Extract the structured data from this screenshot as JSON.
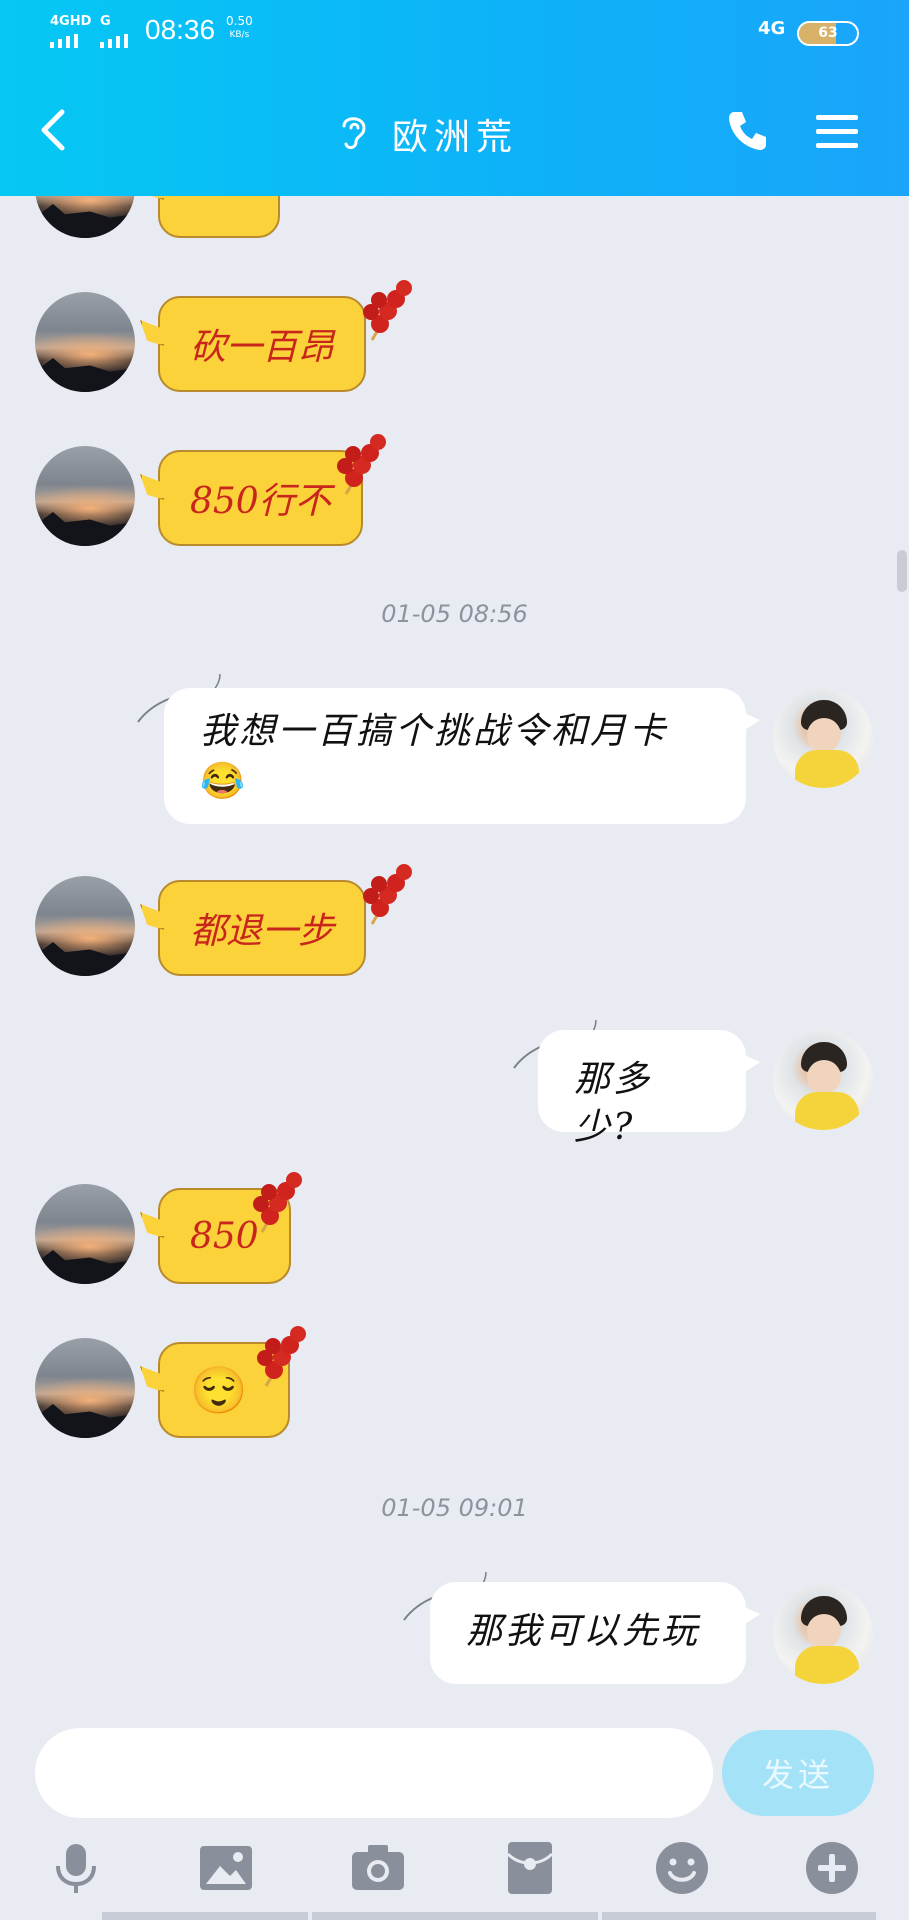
{
  "status_bar": {
    "signal_1": "4GHD",
    "signal_2": "G",
    "time": "08:36",
    "speed_value": "0.50",
    "speed_unit": "KB/s",
    "network_right": "4G",
    "battery": "63",
    "battery_level": 0.63,
    "battery_color": "#d9b26a"
  },
  "header": {
    "title": "欧洲荒",
    "back_icon": "chevron-left-icon",
    "ear_icon": "ear-icon",
    "call_icon": "phone-icon",
    "menu_icon": "hamburger-menu-icon",
    "background": "#0eb1f8"
  },
  "messages": [
    {
      "side": "left",
      "text": ""
    },
    {
      "side": "left",
      "text": "砍一百昂"
    },
    {
      "side": "left",
      "text": "850行不"
    },
    {
      "side": "time",
      "text": "01-05 08:56"
    },
    {
      "side": "right",
      "text": "我想一百搞个挑战令和月卡",
      "emoji": "😂"
    },
    {
      "side": "left",
      "text": "都退一步"
    },
    {
      "side": "right",
      "text": "那多少?"
    },
    {
      "side": "left",
      "text": "850"
    },
    {
      "side": "left",
      "text": "",
      "emoji": "😌"
    },
    {
      "side": "time",
      "text": "01-05 09:01"
    },
    {
      "side": "right",
      "text": "那我可以先玩"
    }
  ],
  "input": {
    "placeholder": "",
    "send_label": "发送"
  },
  "toolbar": {
    "icons": [
      "microphone-icon",
      "image-icon",
      "camera-icon",
      "red-packet-icon",
      "emoji-icon",
      "plus-icon"
    ]
  },
  "colors": {
    "bubble_yellow": "#fbd23a",
    "bubble_text_red": "#c8261c",
    "chat_background": "#e9ebf3",
    "send_button": "#a4e2f8"
  }
}
